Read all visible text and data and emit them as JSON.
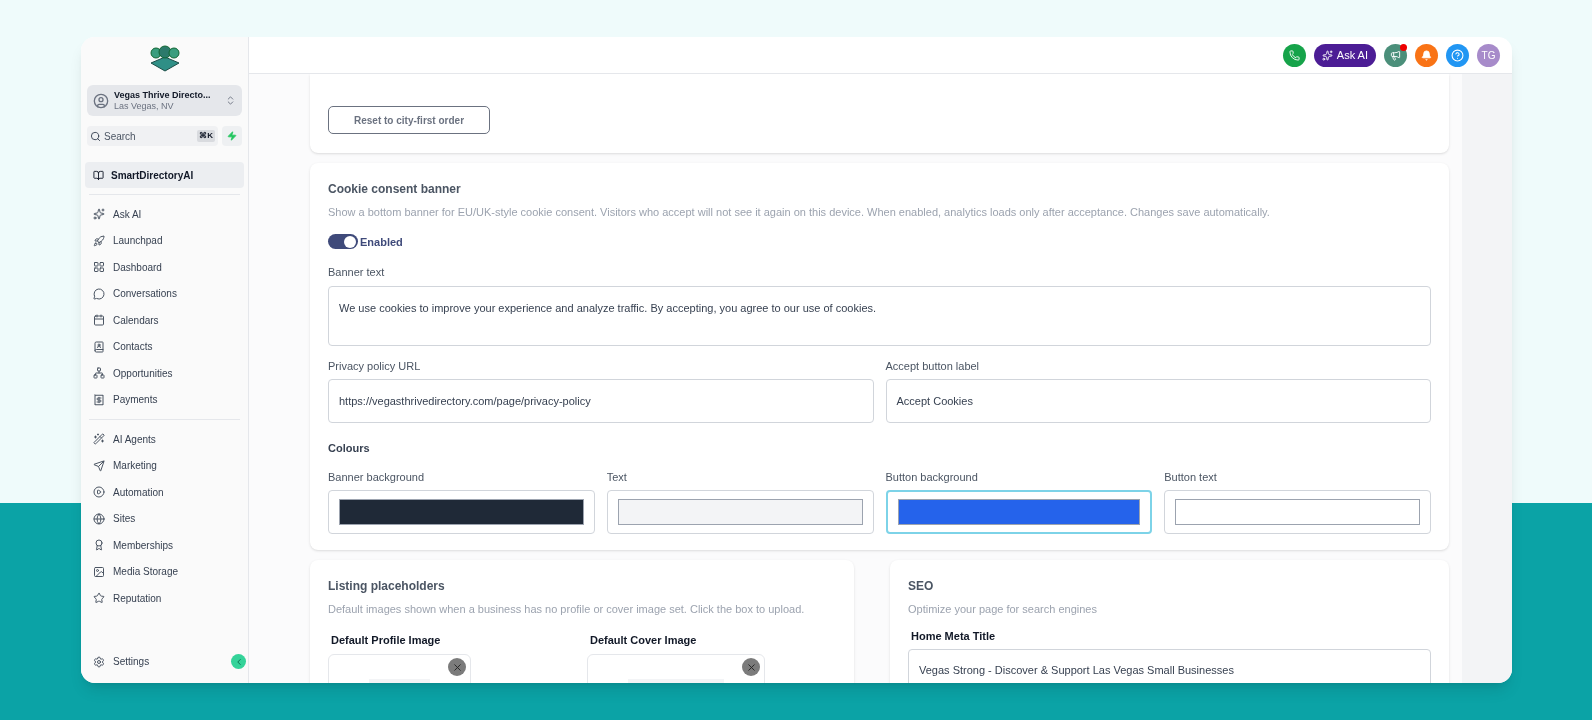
{
  "account": {
    "name": "Vegas Thrive Directo...",
    "location": "Las Vegas, NV"
  },
  "search": {
    "placeholder": "Search",
    "shortcut": "⌘K"
  },
  "workspace": {
    "label": "SmartDirectoryAI",
    "selected": true
  },
  "nav_groups": [
    {
      "items": [
        {
          "label": "Ask AI"
        },
        {
          "label": "Launchpad"
        },
        {
          "label": "Dashboard"
        },
        {
          "label": "Conversations"
        },
        {
          "label": "Calendars"
        },
        {
          "label": "Contacts"
        },
        {
          "label": "Opportunities"
        },
        {
          "label": "Payments"
        }
      ]
    },
    {
      "items": [
        {
          "label": "AI Agents"
        },
        {
          "label": "Marketing"
        },
        {
          "label": "Automation"
        },
        {
          "label": "Sites"
        },
        {
          "label": "Memberships"
        },
        {
          "label": "Media Storage"
        },
        {
          "label": "Reputation"
        }
      ]
    }
  ],
  "settings_item": {
    "label": "Settings"
  },
  "topbar": {
    "ask_ai": "Ask AI",
    "notification_dot": true,
    "avatar": "TG"
  },
  "reset_button": "Reset to city-first order",
  "cookie_banner": {
    "title": "Cookie consent banner",
    "description": "Show a bottom banner for EU/UK-style cookie consent. Visitors who accept will not see it again on this device. When enabled, analytics loads only after acceptance. Changes save automatically.",
    "toggle": {
      "label": "Enabled",
      "on": true
    },
    "banner_text": {
      "label": "Banner text",
      "value": "We use cookies to improve your experience and analyze traffic. By accepting, you agree to our use of cookies."
    },
    "privacy_url": {
      "label": "Privacy policy URL",
      "value": "https://vegasthrivedirectory.com/page/privacy-policy"
    },
    "accept_label": {
      "label": "Accept button label",
      "value": "Accept Cookies"
    },
    "colours_title": "Colours",
    "colours": [
      {
        "label": "Banner background",
        "color": "#1f2937",
        "focused": false
      },
      {
        "label": "Text",
        "color": "#f3f4f6",
        "focused": false
      },
      {
        "label": "Button background",
        "color": "#2563eb",
        "focused": true
      },
      {
        "label": "Button text",
        "color": "#ffffff",
        "focused": false
      }
    ]
  },
  "listing_placeholders": {
    "title": "Listing placeholders",
    "description": "Default images shown when a business has no profile or cover image set. Click the box to upload.",
    "images": [
      {
        "label": "Default Profile Image"
      },
      {
        "label": "Default Cover Image"
      }
    ]
  },
  "seo": {
    "title": "SEO",
    "description": "Optimize your page for search engines",
    "meta_title": {
      "label": "Home Meta Title",
      "value": "Vegas Strong - Discover & Support Las Vegas Small Businesses"
    }
  }
}
